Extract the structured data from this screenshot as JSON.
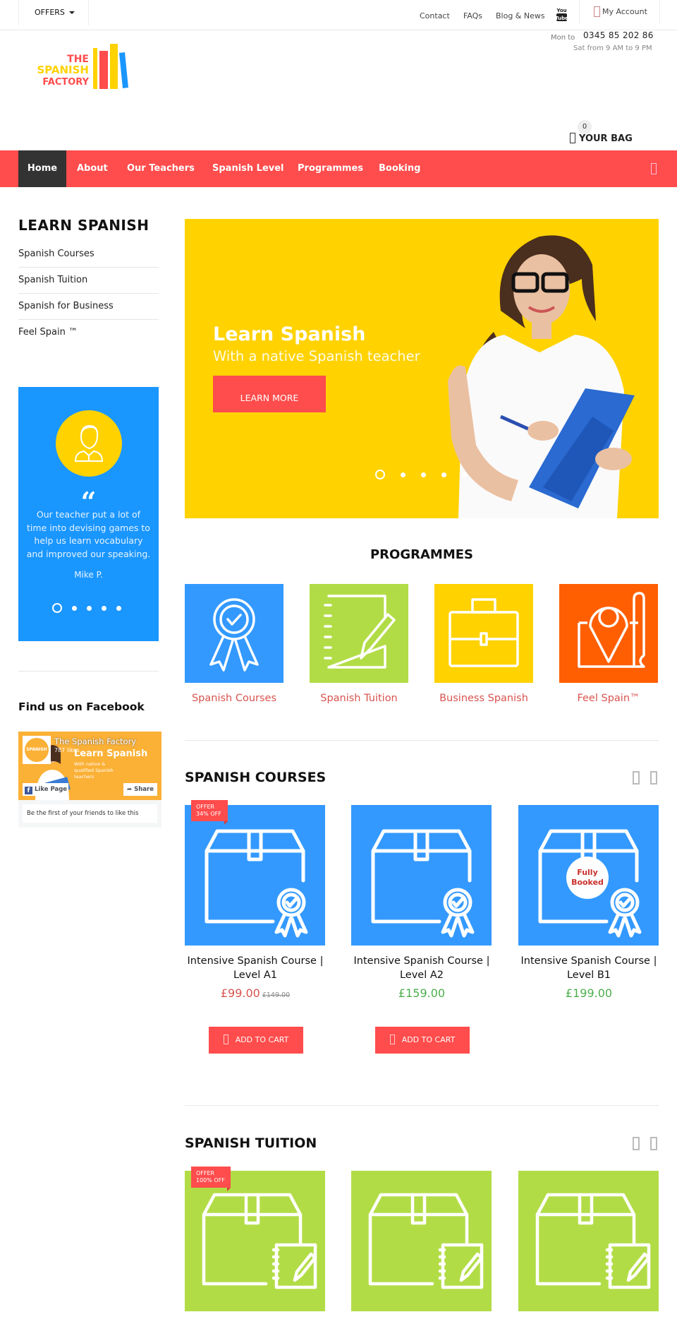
{
  "topbar": {
    "offers_label": "OFFERS",
    "links": [
      "Contact",
      "FAQs",
      "Blog & News"
    ],
    "youtube_icon": "youtube-icon",
    "account_label": "My Account"
  },
  "contact": {
    "hours_label": "Mon to",
    "phone": "0345 85 202 86",
    "hours": "Sat from 9 AM to 9 PM"
  },
  "logo": {
    "line1": "THE",
    "line2": "SPANISH",
    "line3": "FACTORY"
  },
  "bag": {
    "count": "0",
    "label": "YOUR BAG"
  },
  "nav": {
    "items": [
      {
        "label": "Home",
        "active": true
      },
      {
        "label": "About"
      },
      {
        "label": "Our Teachers"
      },
      {
        "label": "Spanish Level"
      },
      {
        "label": "Programmes"
      },
      {
        "label": "Booking"
      }
    ]
  },
  "sidebar": {
    "title": "LEARN SPANISH",
    "items": [
      "Spanish Courses",
      "Spanish Tuition",
      "Spanish for Business",
      "Feel Spain ™"
    ],
    "testimonial": {
      "quote_mark": "“",
      "text": "Our teacher put a lot of time into devising games to help us learn vocabulary and improved our speaking.",
      "author": "Mike P.",
      "slides": 5,
      "active_slide": 1
    },
    "facebook": {
      "title": "Find us on Facebook",
      "page_name": "The Spanish Factory",
      "likes": "787 likes",
      "cover_heading": "Learn Spanish",
      "cover_sub": "With native & qualified Spanish teachers",
      "logo_text": "SPANISH",
      "like_label": "Like Page",
      "share_label": "Share",
      "friends_text": "Be the first of your friends to like this"
    }
  },
  "hero": {
    "heading": "Learn Spanish",
    "subheading": "With a native Spanish teacher",
    "button": "LEARN MORE",
    "slides": 5,
    "active_slide": 1
  },
  "programmes": {
    "title": "PROGRAMMES",
    "items": [
      {
        "label": "Spanish Courses",
        "icon": "award-ribbon-icon",
        "color": "#3399ff"
      },
      {
        "label": "Spanish Tuition",
        "icon": "notebook-pencil-icon",
        "color": "#b2dc46"
      },
      {
        "label": "Business Spanish",
        "icon": "briefcase-icon",
        "color": "#ffd200"
      },
      {
        "label": "Feel Spain™",
        "icon": "map-pin-icon",
        "color": "#ff5f00"
      }
    ]
  },
  "courses": {
    "title": "SPANISH COURSES",
    "products": [
      {
        "name": "Intensive Spanish Course | Level A1",
        "price": "£99.00",
        "old_price": "£149.00",
        "badge": [
          "OFFER",
          "34% OFF"
        ],
        "cart": "ADD TO CART"
      },
      {
        "name": "Intensive Spanish Course | Level A2",
        "price": "£159.00",
        "cart": "ADD TO CART"
      },
      {
        "name": "Intensive Spanish Course | Level B1",
        "price": "£199.00",
        "status": "Fully Booked"
      }
    ]
  },
  "tuition": {
    "title": "SPANISH TUITION",
    "products": [
      {
        "badge": [
          "OFFER",
          "100% OFF"
        ]
      },
      {},
      {}
    ]
  },
  "colors": {
    "accent": "#ff4c4c",
    "nav_active": "#333333",
    "hero_bg": "#ffd200",
    "testimonial_bg": "#1a96ff",
    "course_tile": "#3399ff",
    "tuition_tile": "#b2dc46",
    "price_sale": "#d9534f",
    "price_normal": "#4cae4c"
  }
}
